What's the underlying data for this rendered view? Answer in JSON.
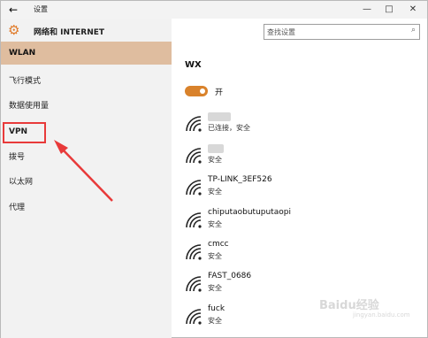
{
  "titlebar": {
    "back": "←",
    "title": "设置",
    "minimize": "—",
    "maximize": "□",
    "close": "✕"
  },
  "sidebar": {
    "title": "网络和 INTERNET",
    "items": [
      {
        "label": "WLAN"
      },
      {
        "label": "飞行模式"
      },
      {
        "label": "数据使用量"
      },
      {
        "label": "VPN"
      },
      {
        "label": "拨号"
      },
      {
        "label": "以太网"
      },
      {
        "label": "代理"
      }
    ]
  },
  "search": {
    "placeholder": "查找设置",
    "icon": "⌕"
  },
  "main": {
    "section_title": "WX",
    "toggle_label": "开",
    "toggle_on": true,
    "networks": [
      {
        "name": "",
        "status": "已连接，安全"
      },
      {
        "name": "",
        "status": "安全"
      },
      {
        "name": "TP-LINK_3EF526",
        "status": "安全"
      },
      {
        "name": "chiputaobutuputaopi",
        "status": "安全"
      },
      {
        "name": "cmcc",
        "status": "安全"
      },
      {
        "name": "FAST_0686",
        "status": "安全"
      },
      {
        "name": "fuck",
        "status": "安全"
      }
    ]
  },
  "watermark": {
    "text": "Baidu经验",
    "sub": "jingyan.baidu.com"
  },
  "colors": {
    "accent": "#d9822b",
    "sidebar_active": "#dfbd9f",
    "annotation_red": "#e83a3a"
  }
}
